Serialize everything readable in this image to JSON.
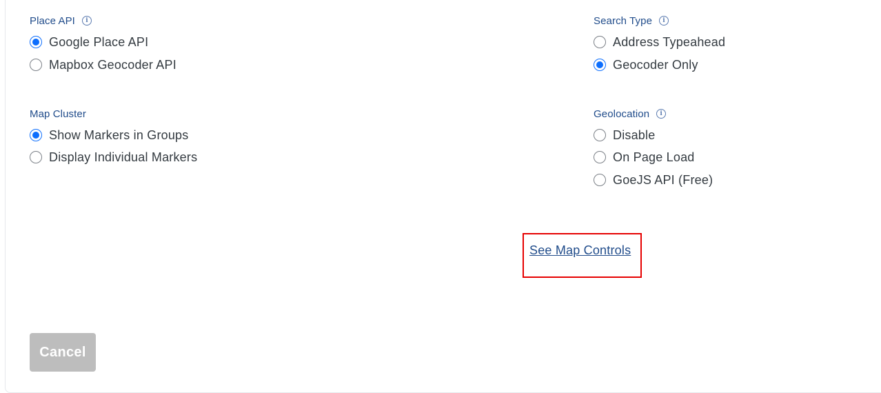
{
  "place_api": {
    "label": "Place API",
    "icon": "info-icon",
    "options": [
      {
        "label": "Google Place API",
        "checked": true
      },
      {
        "label": "Mapbox Geocoder API",
        "checked": false
      }
    ]
  },
  "search_type": {
    "label": "Search Type",
    "icon": "info-icon",
    "options": [
      {
        "label": "Address Typeahead",
        "checked": false
      },
      {
        "label": "Geocoder Only",
        "checked": true
      }
    ]
  },
  "map_cluster": {
    "label": "Map Cluster",
    "options": [
      {
        "label": "Show Markers in Groups",
        "checked": true
      },
      {
        "label": "Display Individual Markers",
        "checked": false
      }
    ]
  },
  "geolocation": {
    "label": "Geolocation",
    "icon": "info-icon",
    "options": [
      {
        "label": "Disable",
        "checked": false
      },
      {
        "label": "On Page Load",
        "checked": false
      },
      {
        "label": "GoeJS API (Free)",
        "checked": false
      }
    ]
  },
  "map_controls_link": "See Map Controls",
  "cancel_label": "Cancel",
  "colors": {
    "accent": "#0d6efd",
    "label": "#1f4b8a",
    "highlight_border": "#e60000",
    "cancel_bg": "#bdbdbd"
  }
}
